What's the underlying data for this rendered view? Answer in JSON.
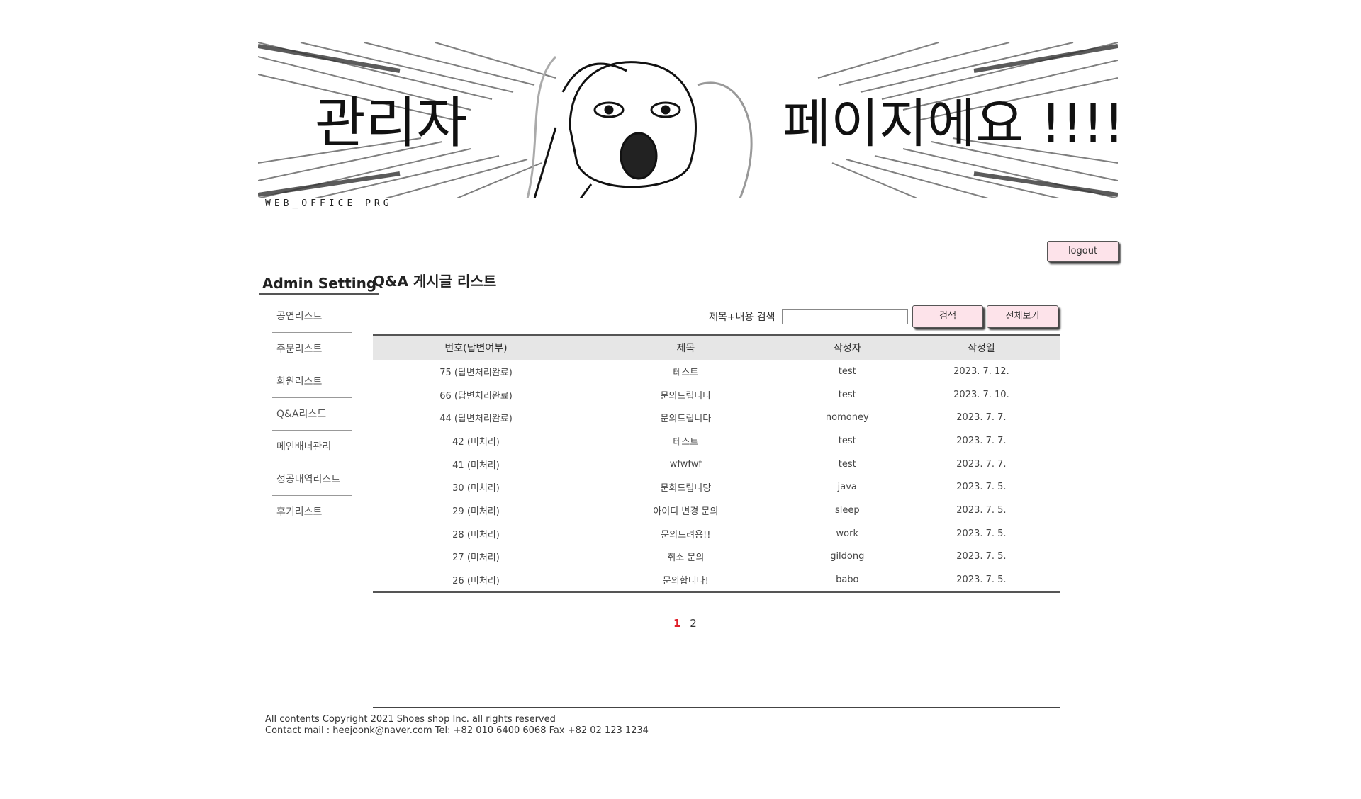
{
  "banner": {
    "text_left": "관리자",
    "text_right": "페이지에요 !!!!!",
    "brand": "WEB_OFFICE PRG"
  },
  "logout_label": "logout",
  "sidebar": {
    "title": "Admin Setting",
    "items": [
      {
        "label": "공연리스트"
      },
      {
        "label": "주문리스트"
      },
      {
        "label": "회원리스트"
      },
      {
        "label": "Q&A리스트"
      },
      {
        "label": "메인배너관리"
      },
      {
        "label": "성공내역리스트"
      },
      {
        "label": "후기리스트"
      }
    ]
  },
  "page_title": "Q&A 게시글 리스트",
  "search": {
    "label": "제목+내용 검색",
    "value": "",
    "button": "검색",
    "view_all": "전체보기"
  },
  "table": {
    "headers": [
      "번호(답변여부)",
      "제목",
      "작성자",
      "작성일"
    ],
    "rows": [
      [
        "75 (답변처리완료)",
        "테스트",
        "test",
        "2023. 7. 12."
      ],
      [
        "66 (답변처리완료)",
        "문의드립니다",
        "test",
        "2023. 7. 10."
      ],
      [
        "44 (답변처리완료)",
        "문의드립니다",
        "nomoney",
        "2023. 7. 7."
      ],
      [
        "42 (미처리)",
        "테스트",
        "test",
        "2023. 7. 7."
      ],
      [
        "41 (미처리)",
        "wfwfwf",
        "test",
        "2023. 7. 7."
      ],
      [
        "30 (미처리)",
        "문희드립니당",
        "java",
        "2023. 7. 5."
      ],
      [
        "29 (미처리)",
        "아이디 변경 문의",
        "sleep",
        "2023. 7. 5."
      ],
      [
        "28 (미처리)",
        "문의드려용!!",
        "work",
        "2023. 7. 5."
      ],
      [
        "27 (미처리)",
        "취소 문의",
        "gildong",
        "2023. 7. 5."
      ],
      [
        "26 (미처리)",
        "문의합니다!",
        "babo",
        "2023. 7. 5."
      ]
    ]
  },
  "pagination": {
    "pages": [
      "1",
      "2"
    ],
    "current": "1"
  },
  "footer": {
    "copyright": "All contents Copyright 2021 Shoes shop Inc. all rights reserved",
    "contact": "Contact mail : heejoonk@naver.com Tel: +82 010 6400 6068 Fax +82 02 123 1234"
  },
  "colors": {
    "button_bg": "#fde3ea",
    "active_page": "#e0202a",
    "header_bg": "#e6e6e6"
  }
}
